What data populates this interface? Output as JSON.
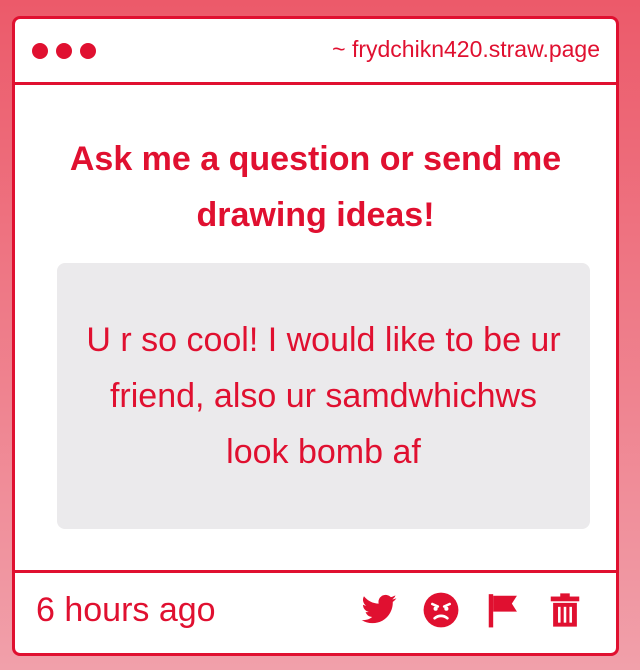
{
  "header": {
    "url": "~ frydchikn420.straw.page"
  },
  "question": {
    "text": "Ask me a question or send me drawing ideas!"
  },
  "answer": {
    "text": "U r so cool! I would like to be ur friend, also ur samdwhichws look bomb af"
  },
  "footer": {
    "timestamp": "6 hours ago",
    "icons": [
      "twitter-icon",
      "angry-face-icon",
      "flag-icon",
      "trash-icon"
    ]
  },
  "colors": {
    "accent": "#e01030",
    "answer_bg": "#ebeaec",
    "background_top": "#ec5a6a",
    "background_bottom": "#f1a0aa"
  }
}
